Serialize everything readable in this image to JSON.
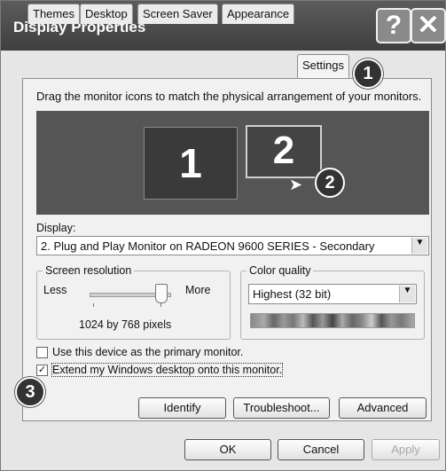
{
  "window": {
    "title": "Display Properties",
    "help_glyph": "?",
    "close_glyph": "✕"
  },
  "tabs": [
    "Themes",
    "Desktop",
    "Screen Saver",
    "Appearance",
    "Settings"
  ],
  "instruction": "Drag the monitor icons to match the physical arrangement of your monitors.",
  "monitors": [
    "1",
    "2"
  ],
  "callouts": [
    "1",
    "2",
    "3"
  ],
  "display": {
    "label": "Display:",
    "value": "2. Plug and Play Monitor on RADEON 9600 SERIES - Secondary"
  },
  "resolution": {
    "label": "Screen resolution",
    "less": "Less",
    "more": "More",
    "value": "1024 by 768 pixels",
    "level": 0.85
  },
  "color_quality": {
    "label": "Color quality",
    "value": "Highest (32 bit)"
  },
  "checkboxes": [
    {
      "label": "Use this device as the primary monitor.",
      "checked": false
    },
    {
      "label": "Extend my Windows desktop onto this monitor.",
      "checked": true
    }
  ],
  "buttons": {
    "identify": "Identify",
    "troubleshoot": "Troubleshoot...",
    "advanced": "Advanced",
    "ok": "OK",
    "cancel": "Cancel",
    "apply": "Apply"
  },
  "colors": {
    "titlebar": "#4a4a4a",
    "monitor_area": "#555555",
    "selected_monitor_border": "#d0d0d0"
  }
}
